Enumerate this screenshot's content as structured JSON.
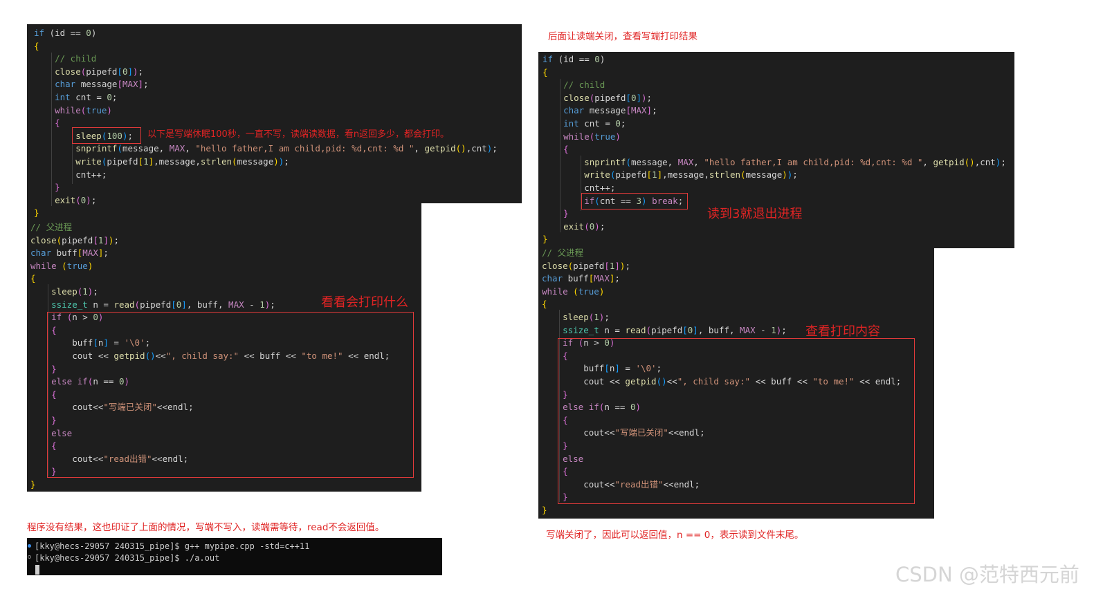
{
  "left": {
    "code_top": [
      [
        [
          "c-kw",
          "if"
        ],
        [
          "c-pl",
          " (id == "
        ],
        [
          "c-num",
          "0"
        ],
        [
          "c-pl",
          ")"
        ]
      ],
      [
        [
          "c-br1",
          "{"
        ]
      ],
      [
        [
          "c-cmt",
          "    // child"
        ]
      ],
      [
        [
          "c-fn",
          "    close"
        ],
        [
          "c-br2",
          "("
        ],
        [
          "c-pl",
          "pipefd"
        ],
        [
          "c-br3",
          "["
        ],
        [
          "c-num",
          "0"
        ],
        [
          "c-br3",
          "]"
        ],
        [
          "c-br2",
          ")"
        ],
        [
          "c-pl",
          ";"
        ]
      ],
      [
        [
          "c-kw",
          "    char"
        ],
        [
          "c-pl",
          " message"
        ],
        [
          "c-br2",
          "["
        ],
        [
          "c-mac",
          "MAX"
        ],
        [
          "c-br2",
          "]"
        ],
        [
          "c-pl",
          ";"
        ]
      ],
      [
        [
          "c-kw",
          "    int"
        ],
        [
          "c-pl",
          " cnt = "
        ],
        [
          "c-num",
          "0"
        ],
        [
          "c-pl",
          ";"
        ]
      ],
      [
        [
          "c-ctl",
          "    while"
        ],
        [
          "c-br2",
          "("
        ],
        [
          "c-kw",
          "true"
        ],
        [
          "c-br2",
          ")"
        ]
      ],
      [
        [
          "c-br2",
          "    {"
        ]
      ],
      [
        [
          "c-fn",
          "        sleep"
        ],
        [
          "c-br3",
          "("
        ],
        [
          "c-num",
          "100"
        ],
        [
          "c-br3",
          ")"
        ],
        [
          "c-pl",
          ";"
        ]
      ],
      [
        [
          "c-fn",
          "        snprintf"
        ],
        [
          "c-br3",
          "("
        ],
        [
          "c-pl",
          "message, "
        ],
        [
          "c-mac",
          "MAX"
        ],
        [
          "c-pl",
          ", "
        ],
        [
          "c-str",
          "\"hello father,I am child,pid: %d,cnt: %d \""
        ],
        [
          "c-pl",
          ", "
        ],
        [
          "c-fn",
          "getpid"
        ],
        [
          "c-br1",
          "()"
        ],
        [
          "c-pl",
          ",cnt"
        ],
        [
          "c-br3",
          ")"
        ],
        [
          "c-pl",
          ";"
        ]
      ],
      [
        [
          "c-fn",
          "        write"
        ],
        [
          "c-br3",
          "("
        ],
        [
          "c-pl",
          "pipefd"
        ],
        [
          "c-br1",
          "["
        ],
        [
          "c-num",
          "1"
        ],
        [
          "c-br1",
          "]"
        ],
        [
          "c-pl",
          ",message,"
        ],
        [
          "c-fn",
          "strlen"
        ],
        [
          "c-br1",
          "("
        ],
        [
          "c-pl",
          "message"
        ],
        [
          "c-br1",
          ")"
        ],
        [
          "c-br3",
          ")"
        ],
        [
          "c-pl",
          ";"
        ]
      ],
      [
        [
          "c-pl",
          "        cnt++;"
        ]
      ],
      [
        [
          "c-br2",
          "    }"
        ]
      ],
      [
        [
          "c-fn",
          "    exit"
        ],
        [
          "c-br2",
          "("
        ],
        [
          "c-num",
          "0"
        ],
        [
          "c-br2",
          ")"
        ],
        [
          "c-pl",
          ";"
        ]
      ],
      [
        [
          "c-br1",
          "}"
        ]
      ]
    ],
    "code_bottom": [
      [
        [
          "c-cmt",
          "// 父进程"
        ]
      ],
      [
        [
          "c-fn",
          "close"
        ],
        [
          "c-br1",
          "("
        ],
        [
          "c-pl",
          "pipefd"
        ],
        [
          "c-br2",
          "["
        ],
        [
          "c-num",
          "1"
        ],
        [
          "c-br2",
          "]"
        ],
        [
          "c-br1",
          ")"
        ],
        [
          "c-pl",
          ";"
        ]
      ],
      [
        [
          "c-kw",
          "char"
        ],
        [
          "c-pl",
          " buff"
        ],
        [
          "c-br1",
          "["
        ],
        [
          "c-mac",
          "MAX"
        ],
        [
          "c-br1",
          "]"
        ],
        [
          "c-pl",
          ";"
        ]
      ],
      [
        [
          "c-ctl",
          "while"
        ],
        [
          "c-pl",
          " "
        ],
        [
          "c-br1",
          "("
        ],
        [
          "c-kw",
          "true"
        ],
        [
          "c-br1",
          ")"
        ]
      ],
      [
        [
          "c-br1",
          "{"
        ]
      ],
      [
        [
          "c-fn",
          "    sleep"
        ],
        [
          "c-br2",
          "("
        ],
        [
          "c-num",
          "1"
        ],
        [
          "c-br2",
          ")"
        ],
        [
          "c-pl",
          ";"
        ]
      ],
      [
        [
          "c-ty",
          "    ssize_t"
        ],
        [
          "c-pl",
          " n = "
        ],
        [
          "c-fn",
          "read"
        ],
        [
          "c-br2",
          "("
        ],
        [
          "c-pl",
          "pipefd"
        ],
        [
          "c-br3",
          "["
        ],
        [
          "c-num",
          "0"
        ],
        [
          "c-br3",
          "]"
        ],
        [
          "c-pl",
          ", buff, "
        ],
        [
          "c-mac",
          "MAX"
        ],
        [
          "c-pl",
          " - "
        ],
        [
          "c-num",
          "1"
        ],
        [
          "c-br2",
          ")"
        ],
        [
          "c-pl",
          ";"
        ]
      ],
      [
        [
          "c-ctl",
          "    if"
        ],
        [
          "c-pl",
          " "
        ],
        [
          "c-br2",
          "("
        ],
        [
          "c-pl",
          "n > "
        ],
        [
          "c-num",
          "0"
        ],
        [
          "c-br2",
          ")"
        ]
      ],
      [
        [
          "c-br2",
          "    {"
        ]
      ],
      [
        [
          "c-pl",
          "        buff"
        ],
        [
          "c-br3",
          "["
        ],
        [
          "c-pl",
          "n"
        ],
        [
          "c-br3",
          "]"
        ],
        [
          "c-pl",
          " = "
        ],
        [
          "c-str",
          "'\\0'"
        ],
        [
          "c-pl",
          ";"
        ]
      ],
      [
        [
          "c-pl",
          "        cout << "
        ],
        [
          "c-fn",
          "getpid"
        ],
        [
          "c-br3",
          "()"
        ],
        [
          "c-pl",
          "<<"
        ],
        [
          "c-str",
          "\", child say:\""
        ],
        [
          "c-pl",
          " << buff << "
        ],
        [
          "c-str",
          "\"to me!\""
        ],
        [
          "c-pl",
          " << endl;"
        ]
      ],
      [
        [
          "c-br2",
          "    }"
        ]
      ],
      [
        [
          "c-ctl",
          "    else if"
        ],
        [
          "c-br2",
          "("
        ],
        [
          "c-pl",
          "n == "
        ],
        [
          "c-num",
          "0"
        ],
        [
          "c-br2",
          ")"
        ]
      ],
      [
        [
          "c-br2",
          "    {"
        ]
      ],
      [
        [
          "c-pl",
          "        cout<<"
        ],
        [
          "c-str",
          "\"写端已关闭\""
        ],
        [
          "c-pl",
          "<<endl;"
        ]
      ],
      [
        [
          "c-br2",
          "    }"
        ]
      ],
      [
        [
          "c-ctl",
          "    else"
        ]
      ],
      [
        [
          "c-br2",
          "    {"
        ]
      ],
      [
        [
          "c-pl",
          "        cout<<"
        ],
        [
          "c-str",
          "\"read出错\""
        ],
        [
          "c-pl",
          "<<endl;"
        ]
      ],
      [
        [
          "c-br2",
          "    }"
        ]
      ],
      [
        [
          "c-br1",
          "}"
        ]
      ]
    ],
    "annotation_sleep": "以下是写端休眠100秒，一直不写，读端读数据，看n返回多少，都会打印。",
    "annotation_print": "看看会打印什么",
    "note_result": "程序没有结果，这也印证了上面的情况，写端不写入，读端需等待，read不会返回值。",
    "terminal": [
      "[kky@hecs-29057 240315_pipe]$ g++ mypipe.cpp -std=c++11",
      "[kky@hecs-29057 240315_pipe]$ ./a.out"
    ]
  },
  "right": {
    "note_top": "后面让读端关闭，查看写端打印结果",
    "code_top": [
      [
        [
          "c-kw",
          "if"
        ],
        [
          "c-pl",
          " (id == "
        ],
        [
          "c-num",
          "0"
        ],
        [
          "c-pl",
          ")"
        ]
      ],
      [
        [
          "c-br1",
          "{"
        ]
      ],
      [
        [
          "c-cmt",
          "    // child"
        ]
      ],
      [
        [
          "c-fn",
          "    close"
        ],
        [
          "c-br2",
          "("
        ],
        [
          "c-pl",
          "pipefd"
        ],
        [
          "c-br3",
          "["
        ],
        [
          "c-num",
          "0"
        ],
        [
          "c-br3",
          "]"
        ],
        [
          "c-br2",
          ")"
        ],
        [
          "c-pl",
          ";"
        ]
      ],
      [
        [
          "c-kw",
          "    char"
        ],
        [
          "c-pl",
          " message"
        ],
        [
          "c-br2",
          "["
        ],
        [
          "c-mac",
          "MAX"
        ],
        [
          "c-br2",
          "]"
        ],
        [
          "c-pl",
          ";"
        ]
      ],
      [
        [
          "c-kw",
          "    int"
        ],
        [
          "c-pl",
          " cnt = "
        ],
        [
          "c-num",
          "0"
        ],
        [
          "c-pl",
          ";"
        ]
      ],
      [
        [
          "c-ctl",
          "    while"
        ],
        [
          "c-br2",
          "("
        ],
        [
          "c-kw",
          "true"
        ],
        [
          "c-br2",
          ")"
        ]
      ],
      [
        [
          "c-br2",
          "    {"
        ]
      ],
      [
        [
          "c-fn",
          "        snprintf"
        ],
        [
          "c-br3",
          "("
        ],
        [
          "c-pl",
          "message, "
        ],
        [
          "c-mac",
          "MAX"
        ],
        [
          "c-pl",
          ", "
        ],
        [
          "c-str",
          "\"hello father,I am child,pid: %d,cnt: %d \""
        ],
        [
          "c-pl",
          ", "
        ],
        [
          "c-fn",
          "getpid"
        ],
        [
          "c-br1",
          "()"
        ],
        [
          "c-pl",
          ",cnt"
        ],
        [
          "c-br3",
          ")"
        ],
        [
          "c-pl",
          ";"
        ]
      ],
      [
        [
          "c-fn",
          "        write"
        ],
        [
          "c-br3",
          "("
        ],
        [
          "c-pl",
          "pipefd"
        ],
        [
          "c-br1",
          "["
        ],
        [
          "c-num",
          "1"
        ],
        [
          "c-br1",
          "]"
        ],
        [
          "c-pl",
          ",message,"
        ],
        [
          "c-fn",
          "strlen"
        ],
        [
          "c-br1",
          "("
        ],
        [
          "c-pl",
          "message"
        ],
        [
          "c-br1",
          ")"
        ],
        [
          "c-br3",
          ")"
        ],
        [
          "c-pl",
          ";"
        ]
      ],
      [
        [
          "c-pl",
          "        cnt++;"
        ]
      ],
      [
        [
          "c-ctl",
          "        if"
        ],
        [
          "c-br3",
          "("
        ],
        [
          "c-pl",
          "cnt == "
        ],
        [
          "c-num",
          "3"
        ],
        [
          "c-br3",
          ")"
        ],
        [
          "c-pl",
          " "
        ],
        [
          "c-ctl",
          "break"
        ],
        [
          "c-pl",
          ";"
        ]
      ],
      [
        [
          "c-br2",
          "    }"
        ]
      ],
      [
        [
          "c-fn",
          "    exit"
        ],
        [
          "c-br2",
          "("
        ],
        [
          "c-num",
          "0"
        ],
        [
          "c-br2",
          ")"
        ],
        [
          "c-pl",
          ";"
        ]
      ],
      [
        [
          "c-br1",
          "}"
        ]
      ]
    ],
    "code_bottom": [
      [
        [
          "c-cmt",
          "// 父进程"
        ]
      ],
      [
        [
          "c-fn",
          "close"
        ],
        [
          "c-br1",
          "("
        ],
        [
          "c-pl",
          "pipefd"
        ],
        [
          "c-br2",
          "["
        ],
        [
          "c-num",
          "1"
        ],
        [
          "c-br2",
          "]"
        ],
        [
          "c-br1",
          ")"
        ],
        [
          "c-pl",
          ";"
        ]
      ],
      [
        [
          "c-kw",
          "char"
        ],
        [
          "c-pl",
          " buff"
        ],
        [
          "c-br1",
          "["
        ],
        [
          "c-mac",
          "MAX"
        ],
        [
          "c-br1",
          "]"
        ],
        [
          "c-pl",
          ";"
        ]
      ],
      [
        [
          "c-ctl",
          "while"
        ],
        [
          "c-pl",
          " "
        ],
        [
          "c-br1",
          "("
        ],
        [
          "c-kw",
          "true"
        ],
        [
          "c-br1",
          ")"
        ]
      ],
      [
        [
          "c-br1",
          "{"
        ]
      ],
      [
        [
          "c-fn",
          "    sleep"
        ],
        [
          "c-br2",
          "("
        ],
        [
          "c-num",
          "1"
        ],
        [
          "c-br2",
          ")"
        ],
        [
          "c-pl",
          ";"
        ]
      ],
      [
        [
          "c-ty",
          "    ssize_t"
        ],
        [
          "c-pl",
          " n = "
        ],
        [
          "c-fn",
          "read"
        ],
        [
          "c-br2",
          "("
        ],
        [
          "c-pl",
          "pipefd"
        ],
        [
          "c-br3",
          "["
        ],
        [
          "c-num",
          "0"
        ],
        [
          "c-br3",
          "]"
        ],
        [
          "c-pl",
          ", buff, "
        ],
        [
          "c-mac",
          "MAX"
        ],
        [
          "c-pl",
          " - "
        ],
        [
          "c-num",
          "1"
        ],
        [
          "c-br2",
          ")"
        ],
        [
          "c-pl",
          ";"
        ]
      ],
      [
        [
          "c-ctl",
          "    if"
        ],
        [
          "c-pl",
          " "
        ],
        [
          "c-br2",
          "("
        ],
        [
          "c-pl",
          "n > "
        ],
        [
          "c-num",
          "0"
        ],
        [
          "c-br2",
          ")"
        ]
      ],
      [
        [
          "c-br2",
          "    {"
        ]
      ],
      [
        [
          "c-pl",
          "        buff"
        ],
        [
          "c-br3",
          "["
        ],
        [
          "c-pl",
          "n"
        ],
        [
          "c-br3",
          "]"
        ],
        [
          "c-pl",
          " = "
        ],
        [
          "c-str",
          "'\\0'"
        ],
        [
          "c-pl",
          ";"
        ]
      ],
      [
        [
          "c-pl",
          "        cout << "
        ],
        [
          "c-fn",
          "getpid"
        ],
        [
          "c-br3",
          "()"
        ],
        [
          "c-pl",
          "<<"
        ],
        [
          "c-str",
          "\", child say:\""
        ],
        [
          "c-pl",
          " << buff << "
        ],
        [
          "c-str",
          "\"to me!\""
        ],
        [
          "c-pl",
          " << endl;"
        ]
      ],
      [
        [
          "c-br2",
          "    }"
        ]
      ],
      [
        [
          "c-ctl",
          "    else if"
        ],
        [
          "c-br2",
          "("
        ],
        [
          "c-pl",
          "n == "
        ],
        [
          "c-num",
          "0"
        ],
        [
          "c-br2",
          ")"
        ]
      ],
      [
        [
          "c-br2",
          "    {"
        ]
      ],
      [
        [
          "c-pl",
          "        cout<<"
        ],
        [
          "c-str",
          "\"写端已关闭\""
        ],
        [
          "c-pl",
          "<<endl;"
        ]
      ],
      [
        [
          "c-br2",
          "    }"
        ]
      ],
      [
        [
          "c-ctl",
          "    else"
        ]
      ],
      [
        [
          "c-br2",
          "    {"
        ]
      ],
      [
        [
          "c-pl",
          "        cout<<"
        ],
        [
          "c-str",
          "\"read出错\""
        ],
        [
          "c-pl",
          "<<endl;"
        ]
      ],
      [
        [
          "c-br2",
          "    }"
        ]
      ],
      [
        [
          "c-br1",
          "}"
        ]
      ]
    ],
    "annotation_break": "读到3就退出进程",
    "annotation_print": "查看打印内容",
    "note_bottom": "写端关闭了，因此可以返回值，n == 0，表示读到文件末尾。"
  },
  "watermark": "CSDN @范特西元前"
}
